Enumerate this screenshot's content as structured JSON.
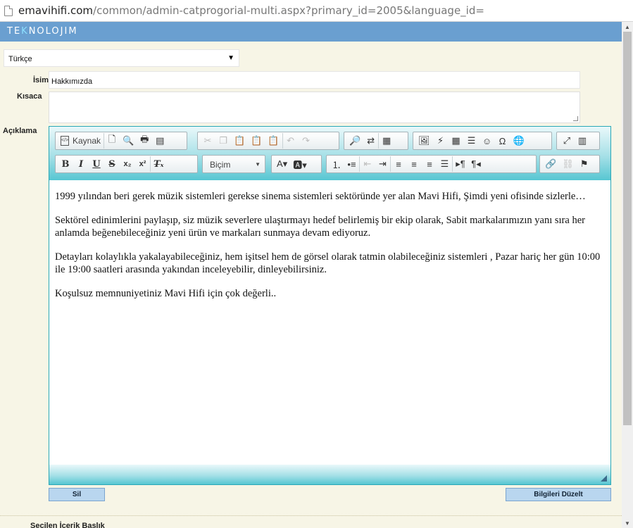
{
  "browser": {
    "url_host": "emavihifi.com",
    "url_path": "/common/admin-catprogorial-multi.aspx?primary_id=2005&language_id="
  },
  "brand": {
    "name_first": "TE",
    "name_accent": "K",
    "name_rest": "NOLOJIM"
  },
  "form": {
    "language_value": "Türkçe",
    "name_label": "İsim",
    "name_value": "Hakkımızda",
    "summary_label": "Kısaca",
    "summary_value": "",
    "description_label": "Açıklama"
  },
  "editor": {
    "toolbar": {
      "source_label": "Kaynak",
      "format_label": "Biçim"
    },
    "paragraphs": [
      "1999 yılından beri gerek müzik sistemleri gerekse sinema sistemleri sektöründe yer alan Mavi Hifi, Şimdi yeni ofisinde sizlerle…",
      "Sektörel edinimlerini paylaşıp, siz müzik severlere ulaştırmayı hedef belirlemiş bir ekip olarak, Sabit markalarımızın yanı sıra her anlamda beğenebileceğiniz yeni ürün ve markaları sunmaya devam ediyoruz.",
      "Detayları kolaylıkla yakalayabileceğiniz, hem işitsel hem de görsel olarak tatmin olabileceğiniz sistemleri , Pazar hariç her gün 10:00 ile 19:00 saatleri arasında yakından inceleyebilir, dinleyebilirsiniz.",
      "Koşulsuz memnuniyetiniz Mavi Hifi için çok değerli.."
    ]
  },
  "actions": {
    "delete_label": "Sil",
    "update_label": "Bilgileri Düzelt"
  },
  "footer": {
    "selected_title_label": "Seçilen İçerik Başlık"
  },
  "colors": {
    "brand_bar": "#6a9fd0",
    "page_bg": "#f7f5e6",
    "editor_border": "#2aa8b7",
    "button_bg": "#b9d6ef"
  }
}
